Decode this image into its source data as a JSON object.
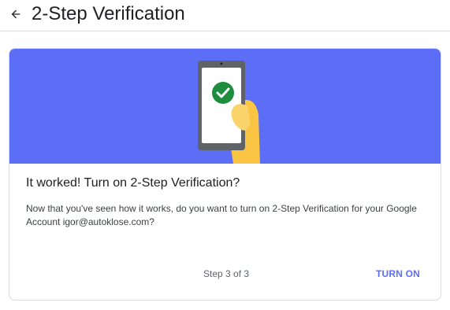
{
  "header": {
    "back_icon": "arrow-back-icon",
    "title": "2-Step Verification"
  },
  "card": {
    "hero_color": "#5c6ef6",
    "illustration": "phone-checkmark-illustration",
    "title": "It worked! Turn on 2-Step Verification?",
    "body_line1": "Now that you've seen how it works, do you want to turn on 2-Step Verification for your Google",
    "body_line2": "Account igor@autoklose.com?",
    "step_text": "Step 3 of 3",
    "turn_on_label": "TURN ON",
    "accent_color": "#5c6ef6"
  }
}
